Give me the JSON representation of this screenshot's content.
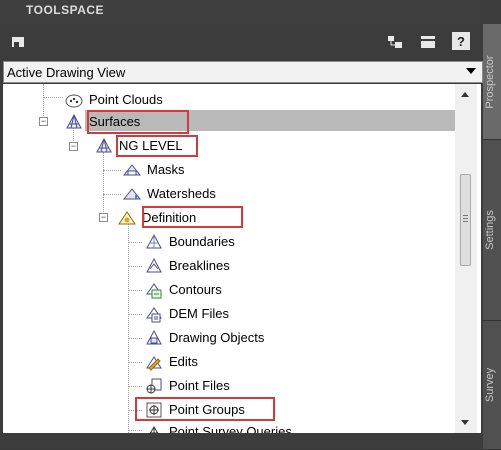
{
  "title": "TOOLSPACE",
  "toolbar": {
    "left_icon": "drawing-icon",
    "icons": [
      "item-view-icon",
      "list-view-icon",
      "help-icon"
    ],
    "help_label": "?"
  },
  "view_select": {
    "value": "Active Drawing View"
  },
  "side_tabs": [
    "Prospector",
    "Settings",
    "Survey"
  ],
  "tree": {
    "items": [
      {
        "label": "Point Clouds",
        "icon": "point-clouds-icon"
      },
      {
        "label": "Surfaces",
        "icon": "surfaces-icon",
        "selected": true,
        "highlighted": true
      },
      {
        "label": "NG LEVEL",
        "icon": "surface-icon",
        "highlighted": true
      },
      {
        "label": "Masks",
        "icon": "masks-icon"
      },
      {
        "label": "Watersheds",
        "icon": "watersheds-icon"
      },
      {
        "label": "Definition",
        "icon": "definition-icon",
        "highlighted": true
      },
      {
        "label": "Boundaries",
        "icon": "boundaries-icon"
      },
      {
        "label": "Breaklines",
        "icon": "breaklines-icon"
      },
      {
        "label": "Contours",
        "icon": "contours-icon"
      },
      {
        "label": "DEM Files",
        "icon": "dem-files-icon"
      },
      {
        "label": "Drawing Objects",
        "icon": "drawing-objects-icon"
      },
      {
        "label": "Edits",
        "icon": "edits-icon"
      },
      {
        "label": "Point Files",
        "icon": "point-files-icon"
      },
      {
        "label": "Point Groups",
        "icon": "point-groups-icon",
        "highlighted": true
      },
      {
        "label": "Point Survey Queries",
        "icon": "point-survey-queries-icon"
      }
    ]
  },
  "colors": {
    "highlight_box": "#d23b3b",
    "selection": "#b9b9b9",
    "panel_dark": "#3c3c3c"
  }
}
